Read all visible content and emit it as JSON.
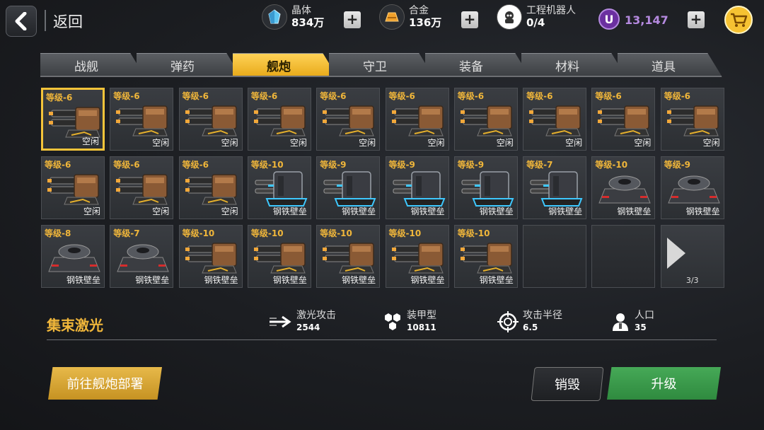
{
  "header": {
    "back_label": "返回"
  },
  "resources": [
    {
      "name": "crystal",
      "label": "晶体",
      "value": "834万"
    },
    {
      "name": "alloy",
      "label": "合金",
      "value": "136万"
    },
    {
      "name": "robot",
      "label": "工程机器人",
      "value": "0/4"
    }
  ],
  "premium": {
    "symbol": "U",
    "value": "13,147"
  },
  "tabs": [
    "战舰",
    "弹药",
    "舰炮",
    "守卫",
    "装备",
    "材料",
    "道具"
  ],
  "active_tab": "舰炮",
  "grid": [
    {
      "level": "等级-6",
      "status": "空闲",
      "kind": "cannon",
      "selected": true
    },
    {
      "level": "等级-6",
      "status": "空闲",
      "kind": "cannon"
    },
    {
      "level": "等级-6",
      "status": "空闲",
      "kind": "cannon"
    },
    {
      "level": "等级-6",
      "status": "空闲",
      "kind": "cannon"
    },
    {
      "level": "等级-6",
      "status": "空闲",
      "kind": "cannon"
    },
    {
      "level": "等级-6",
      "status": "空闲",
      "kind": "cannon"
    },
    {
      "level": "等级-6",
      "status": "空闲",
      "kind": "cannon"
    },
    {
      "level": "等级-6",
      "status": "空闲",
      "kind": "cannon"
    },
    {
      "level": "等级-6",
      "status": "空闲",
      "kind": "cannon"
    },
    {
      "level": "等级-6",
      "status": "空闲",
      "kind": "cannon"
    },
    {
      "level": "等级-6",
      "status": "空闲",
      "kind": "cannon"
    },
    {
      "level": "等级-6",
      "status": "空闲",
      "kind": "cannon"
    },
    {
      "level": "等级-6",
      "status": "空闲",
      "kind": "cannon"
    },
    {
      "level": "等级-10",
      "status": "钢铁壁垒",
      "kind": "laser"
    },
    {
      "level": "等级-9",
      "status": "钢铁壁垒",
      "kind": "laser"
    },
    {
      "level": "等级-9",
      "status": "钢铁壁垒",
      "kind": "laser"
    },
    {
      "level": "等级-9",
      "status": "钢铁壁垒",
      "kind": "laser"
    },
    {
      "level": "等级-7",
      "status": "钢铁壁垒",
      "kind": "laser"
    },
    {
      "level": "等级-10",
      "status": "钢铁壁垒",
      "kind": "bunker"
    },
    {
      "level": "等级-9",
      "status": "钢铁壁垒",
      "kind": "bunker"
    },
    {
      "level": "等级-8",
      "status": "钢铁壁垒",
      "kind": "bunker"
    },
    {
      "level": "等级-7",
      "status": "钢铁壁垒",
      "kind": "bunker"
    },
    {
      "level": "等级-10",
      "status": "钢铁壁垒",
      "kind": "cannon"
    },
    {
      "level": "等级-10",
      "status": "钢铁壁垒",
      "kind": "cannon"
    },
    {
      "level": "等级-10",
      "status": "钢铁壁垒",
      "kind": "cannon"
    },
    {
      "level": "等级-10",
      "status": "钢铁壁垒",
      "kind": "cannon"
    },
    {
      "level": "等级-10",
      "status": "钢铁壁垒",
      "kind": "cannon"
    },
    {
      "kind": "empty"
    },
    {
      "kind": "empty"
    },
    {
      "kind": "next",
      "page": "3/3"
    }
  ],
  "selected": {
    "name": "集束激光"
  },
  "stats": [
    {
      "name": "attack",
      "label": "激光攻击",
      "value": "2544"
    },
    {
      "name": "armor",
      "label": "装甲型",
      "value": "10811"
    },
    {
      "name": "range",
      "label": "攻击半径",
      "value": "6.5"
    },
    {
      "name": "population",
      "label": "人口",
      "value": "35"
    }
  ],
  "buttons": {
    "deploy": "前往舰炮部署",
    "destroy": "销毁",
    "upgrade": "升级"
  }
}
